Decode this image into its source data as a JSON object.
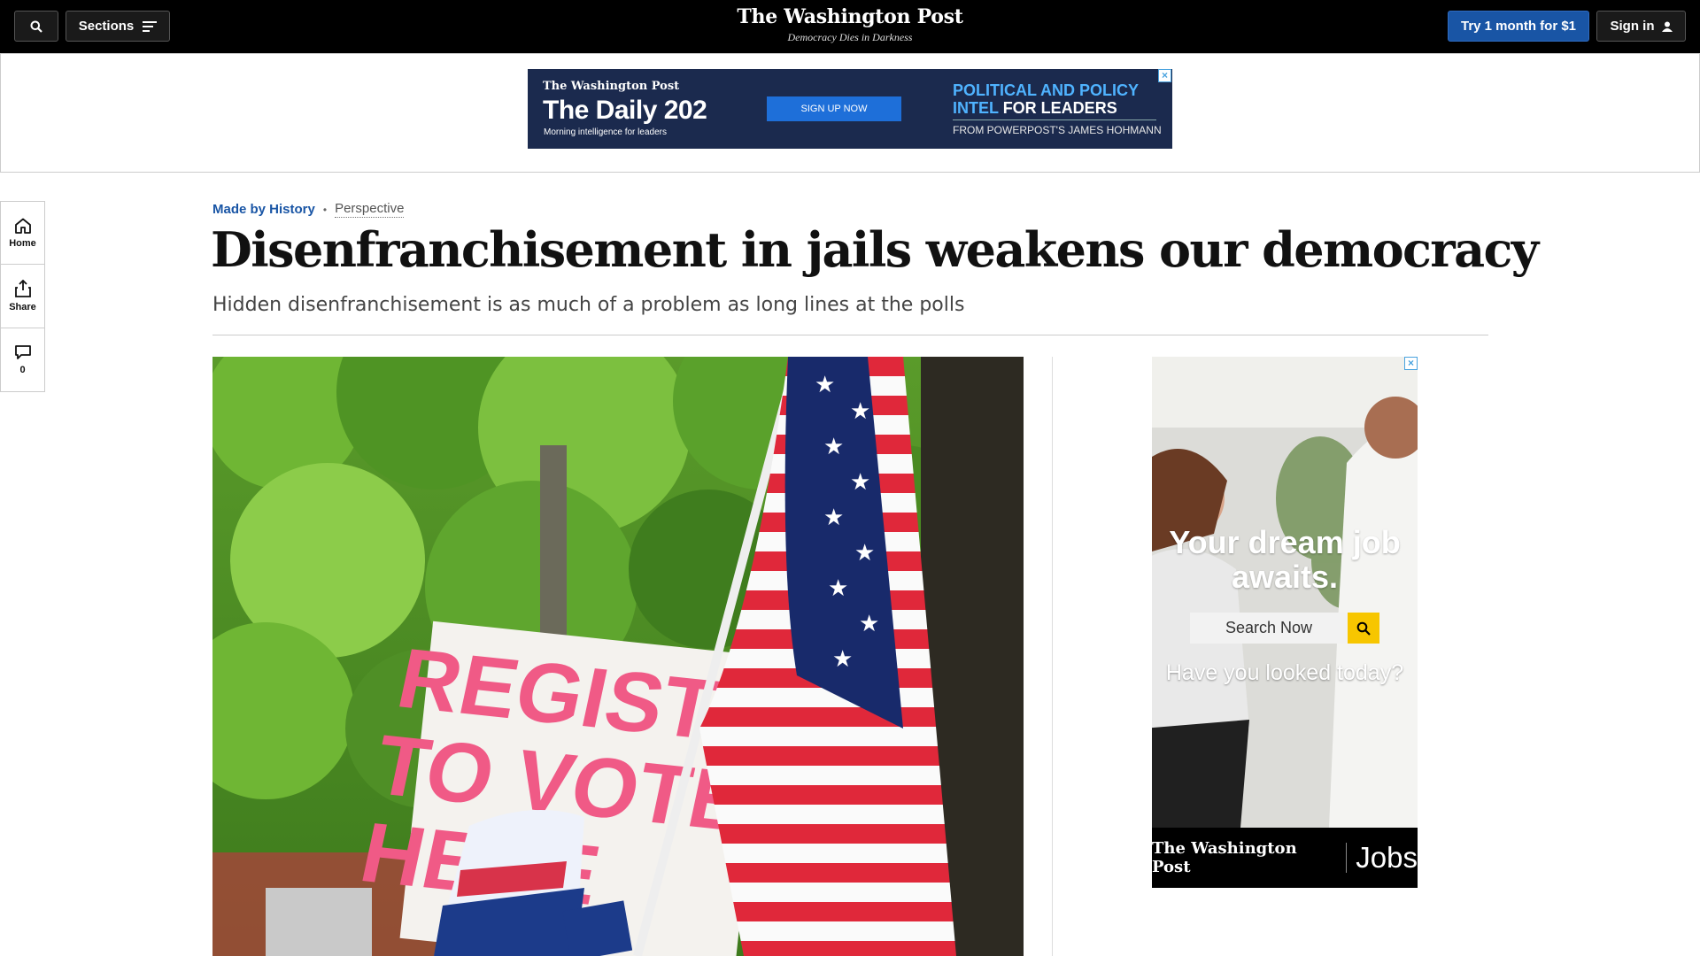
{
  "nav": {
    "sections_label": "Sections",
    "logo": "The Washington Post",
    "tagline": "Democracy Dies in Darkness",
    "try_label": "Try 1 month for $1",
    "signin_label": "Sign in"
  },
  "top_ad": {
    "brand": "The Washington Post",
    "title": "The Daily 202",
    "subtitle": "Morning intelligence for leaders",
    "cta": "SIGN UP NOW",
    "headline_blue": "POLITICAL AND POLICY INTEL",
    "headline_white": "FOR LEADERS",
    "byline": "FROM POWERPOST'S JAMES HOHMANN",
    "close": "×"
  },
  "rail": {
    "home": "Home",
    "share": "Share",
    "comments_count": "0"
  },
  "article": {
    "section": "Made by History",
    "label": "Perspective",
    "headline": "Disenfranchisement in jails weakens our democracy",
    "dek": "Hidden disenfranchisement is as much of a problem as long lines at the polls"
  },
  "side_ad": {
    "headline": "Your dream job awaits.",
    "search_label": "Search Now",
    "question": "Have you looked today?",
    "footer_brand": "The Washington Post",
    "footer_product": "Jobs",
    "close": "×"
  },
  "photo": {
    "sign_line1": "REGISTER",
    "sign_line2": "TO VOTE",
    "sign_line3": "HERE"
  },
  "colors": {
    "nav_bg": "#000000",
    "accent_blue": "#1955a5",
    "ad_navy": "#1b2a4e",
    "ad_yellow": "#f7c600"
  }
}
